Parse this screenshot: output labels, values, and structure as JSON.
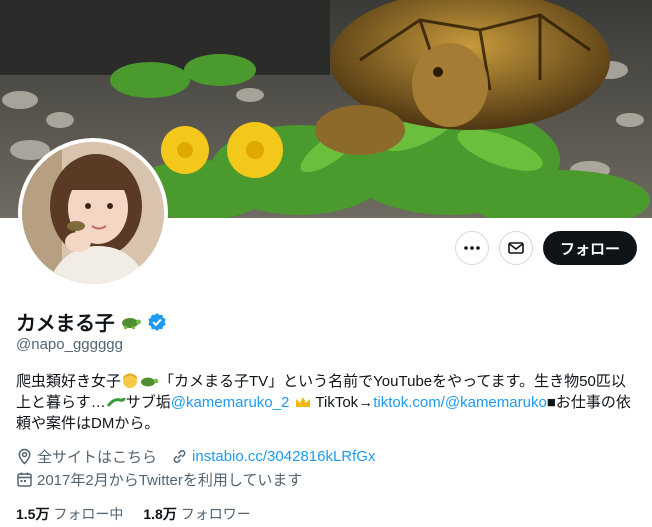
{
  "profile": {
    "display_name": "カメまる子",
    "name_emoji": "tortoise-emoji",
    "verified_badge": "verified-badge-icon",
    "handle": "@napo_gggggg"
  },
  "actions": {
    "more_icon": "more-icon",
    "message_icon": "mail-icon",
    "follow_label": "フォロー"
  },
  "bio": {
    "t1": "爬虫類好き女子",
    "t2": "「カメまる子TV」という名前でYouTubeをやってます。生き物50匹以上と暮らす…",
    "t3": "サブ垢",
    "sub_handle": "@kamemaruko_2",
    "t4": " TikTok→",
    "tiktok_link": "tiktok.com/@kamemaruko",
    "t5": "■お仕事の依頼や案件はDMから。"
  },
  "meta": {
    "location": "全サイトはこちら",
    "website": "instabio.cc/3042816kLRfGx",
    "joined": "2017年2月からTwitterを利用しています"
  },
  "stats": {
    "following_count": "1.5万",
    "following_label": "フォロー中",
    "followers_count": "1.8万",
    "followers_label": "フォロワー"
  },
  "colors": {
    "accent": "#1d9bf0",
    "follow_bg": "#0f1419",
    "muted": "#536471"
  }
}
